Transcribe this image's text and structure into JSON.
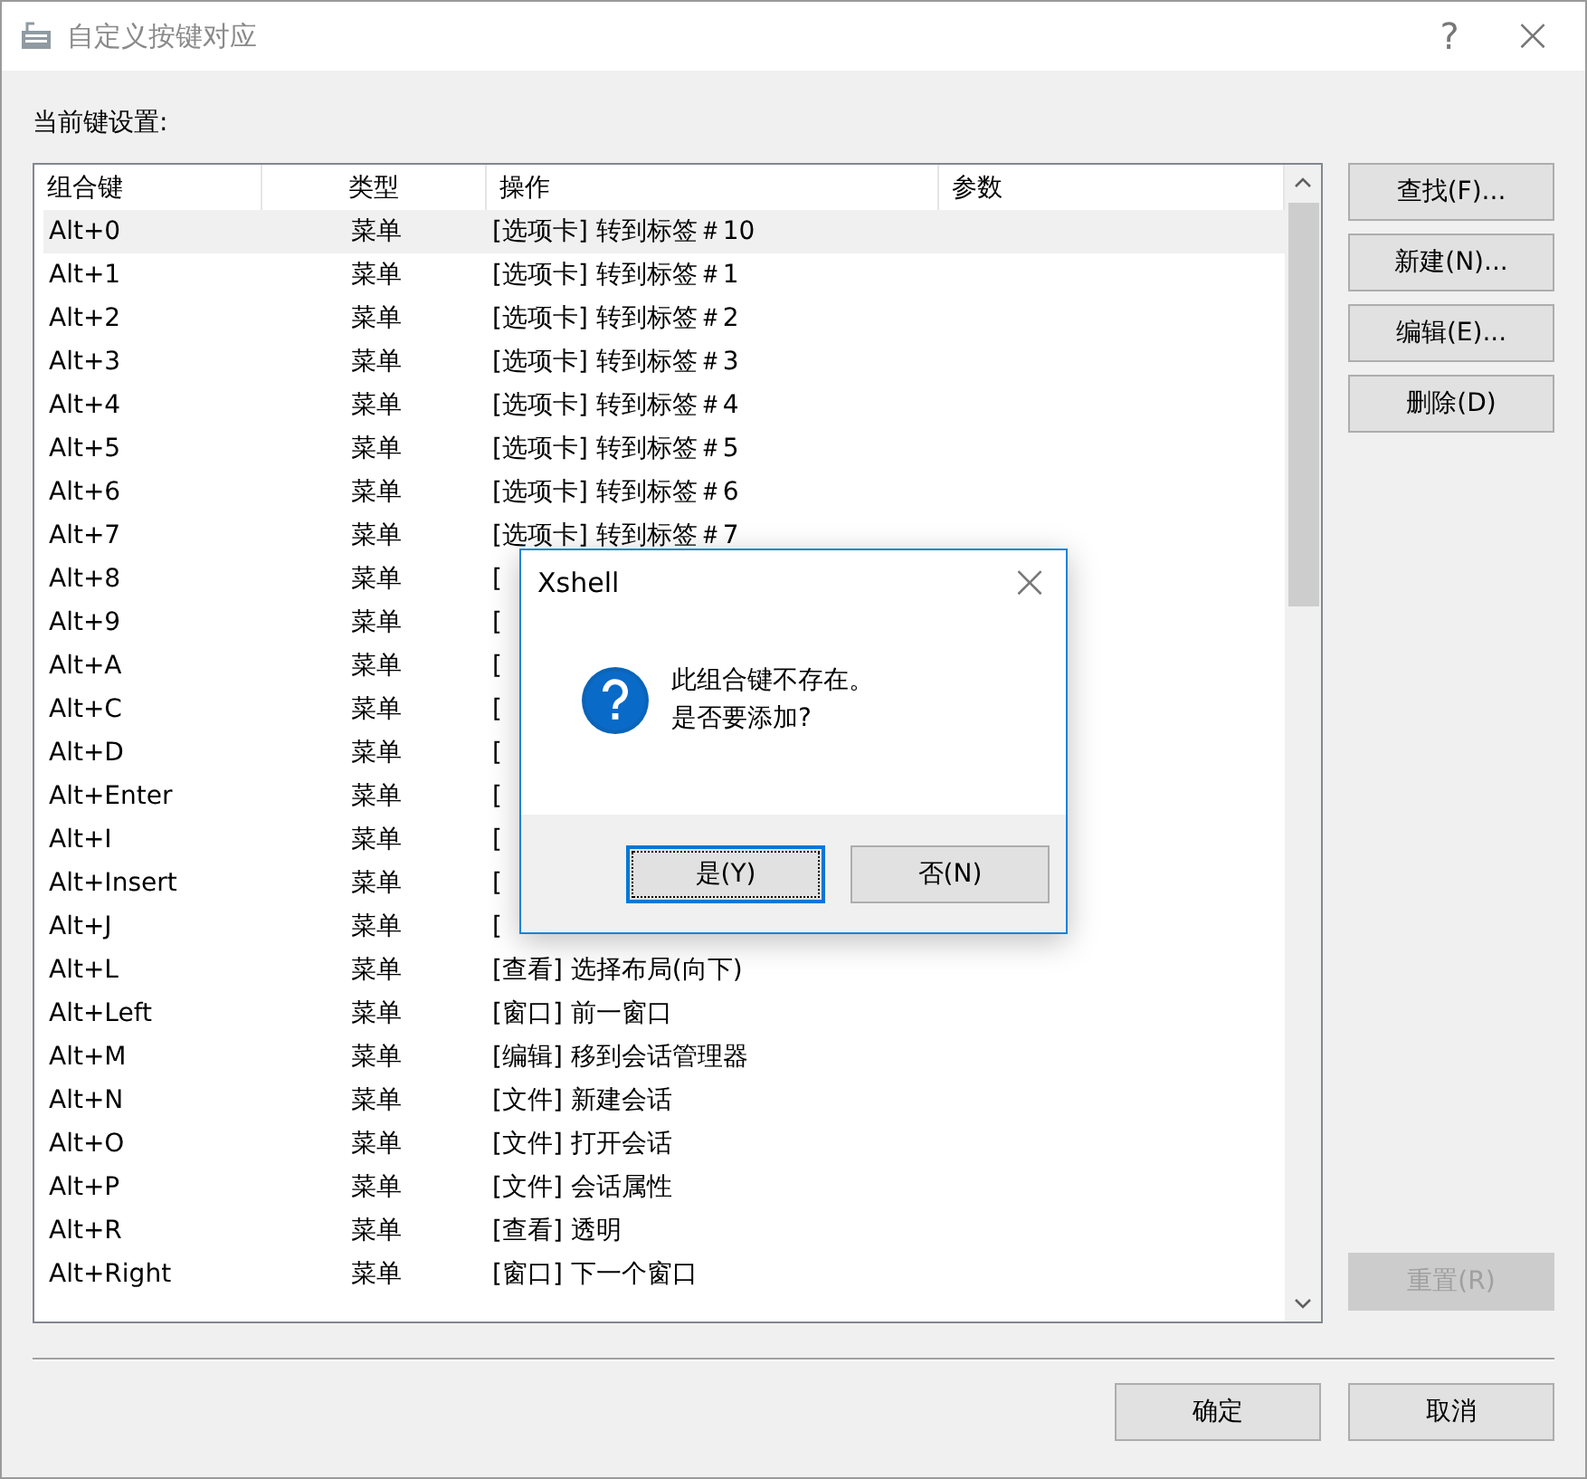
{
  "window": {
    "title": "自定义按键对应",
    "help": "?",
    "close": "×"
  },
  "list_label": "当前键设置:",
  "table": {
    "columns": [
      "组合键",
      "类型",
      "操作",
      "参数"
    ],
    "rows": [
      {
        "key": "Alt+0",
        "type": "菜单",
        "action": "[选项卡] 转到标签＃10",
        "selected": true
      },
      {
        "key": "Alt+1",
        "type": "菜单",
        "action": "[选项卡] 转到标签＃1",
        "selected": false
      },
      {
        "key": "Alt+2",
        "type": "菜单",
        "action": "[选项卡] 转到标签＃2",
        "selected": false
      },
      {
        "key": "Alt+3",
        "type": "菜单",
        "action": "[选项卡] 转到标签＃3",
        "selected": false
      },
      {
        "key": "Alt+4",
        "type": "菜单",
        "action": "[选项卡] 转到标签＃4",
        "selected": false
      },
      {
        "key": "Alt+5",
        "type": "菜单",
        "action": "[选项卡] 转到标签＃5",
        "selected": false
      },
      {
        "key": "Alt+6",
        "type": "菜单",
        "action": "[选项卡] 转到标签＃6",
        "selected": false
      },
      {
        "key": "Alt+7",
        "type": "菜单",
        "action": "[选项卡] 转到标签＃7",
        "selected": false
      },
      {
        "key": "Alt+8",
        "type": "菜单",
        "action": "[",
        "selected": false
      },
      {
        "key": "Alt+9",
        "type": "菜单",
        "action": "[",
        "selected": false
      },
      {
        "key": "Alt+A",
        "type": "菜单",
        "action": "[",
        "selected": false
      },
      {
        "key": "Alt+C",
        "type": "菜单",
        "action": "[",
        "selected": false
      },
      {
        "key": "Alt+D",
        "type": "菜单",
        "action": "[",
        "selected": false
      },
      {
        "key": "Alt+Enter",
        "type": "菜单",
        "action": "[",
        "selected": false
      },
      {
        "key": "Alt+I",
        "type": "菜单",
        "action": "[",
        "selected": false
      },
      {
        "key": "Alt+Insert",
        "type": "菜单",
        "action": "[",
        "selected": false
      },
      {
        "key": "Alt+J",
        "type": "菜单",
        "action": "[",
        "selected": false
      },
      {
        "key": "Alt+L",
        "type": "菜单",
        "action": "[查看] 选择布局(向下)",
        "selected": false
      },
      {
        "key": "Alt+Left",
        "type": "菜单",
        "action": "[窗口] 前一窗口",
        "selected": false
      },
      {
        "key": "Alt+M",
        "type": "菜单",
        "action": "[编辑] 移到会话管理器",
        "selected": false
      },
      {
        "key": "Alt+N",
        "type": "菜单",
        "action": "[文件] 新建会话",
        "selected": false
      },
      {
        "key": "Alt+O",
        "type": "菜单",
        "action": "[文件] 打开会话",
        "selected": false
      },
      {
        "key": "Alt+P",
        "type": "菜单",
        "action": "[文件] 会话属性",
        "selected": false
      },
      {
        "key": "Alt+R",
        "type": "菜单",
        "action": "[查看] 透明",
        "selected": false
      },
      {
        "key": "Alt+Right",
        "type": "菜单",
        "action": "[窗口] 下一个窗口",
        "selected": false
      }
    ]
  },
  "side_buttons": [
    {
      "label": "查找(F)...",
      "disabled": false
    },
    {
      "label": "新建(N)...",
      "disabled": false
    },
    {
      "label": "编辑(E)...",
      "disabled": false
    },
    {
      "label": "删除(D)",
      "disabled": false
    }
  ],
  "reset_button": {
    "label": "重置(R)",
    "disabled": true
  },
  "footer_buttons": [
    "确定",
    "取消"
  ],
  "message_box": {
    "title": "Xshell",
    "close": "×",
    "message_lines": [
      "此组合键不存在。",
      "是否要添加?"
    ],
    "buttons": [
      {
        "label": "是(Y)",
        "focused": true
      },
      {
        "label": "否(N)",
        "focused": false
      }
    ]
  }
}
